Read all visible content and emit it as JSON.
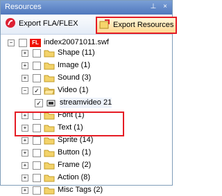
{
  "window": {
    "title": "Resources",
    "controls": [
      "pin-icon",
      "close-icon"
    ]
  },
  "toolbar": {
    "export_fla": "Export FLA/FLEX",
    "export_resources": "Export Resources"
  },
  "tree": {
    "root": "index20071011.swf",
    "items": [
      {
        "label": "Shape (11)",
        "expanded": false
      },
      {
        "label": "Image (1)",
        "expanded": false
      },
      {
        "label": "Sound (3)",
        "expanded": false
      },
      {
        "label": "Video (1)",
        "expanded": true,
        "checked": true,
        "children": [
          "streamvideo 21"
        ]
      },
      {
        "label": "Font (1)",
        "expanded": false
      },
      {
        "label": "Text (1)",
        "expanded": false
      },
      {
        "label": "Sprite (14)",
        "expanded": false
      },
      {
        "label": "Button (1)",
        "expanded": false
      },
      {
        "label": "Frame (2)",
        "expanded": false
      },
      {
        "label": "Action (8)",
        "expanded": false
      },
      {
        "label": "Misc Tags (2)",
        "expanded": false
      }
    ]
  }
}
